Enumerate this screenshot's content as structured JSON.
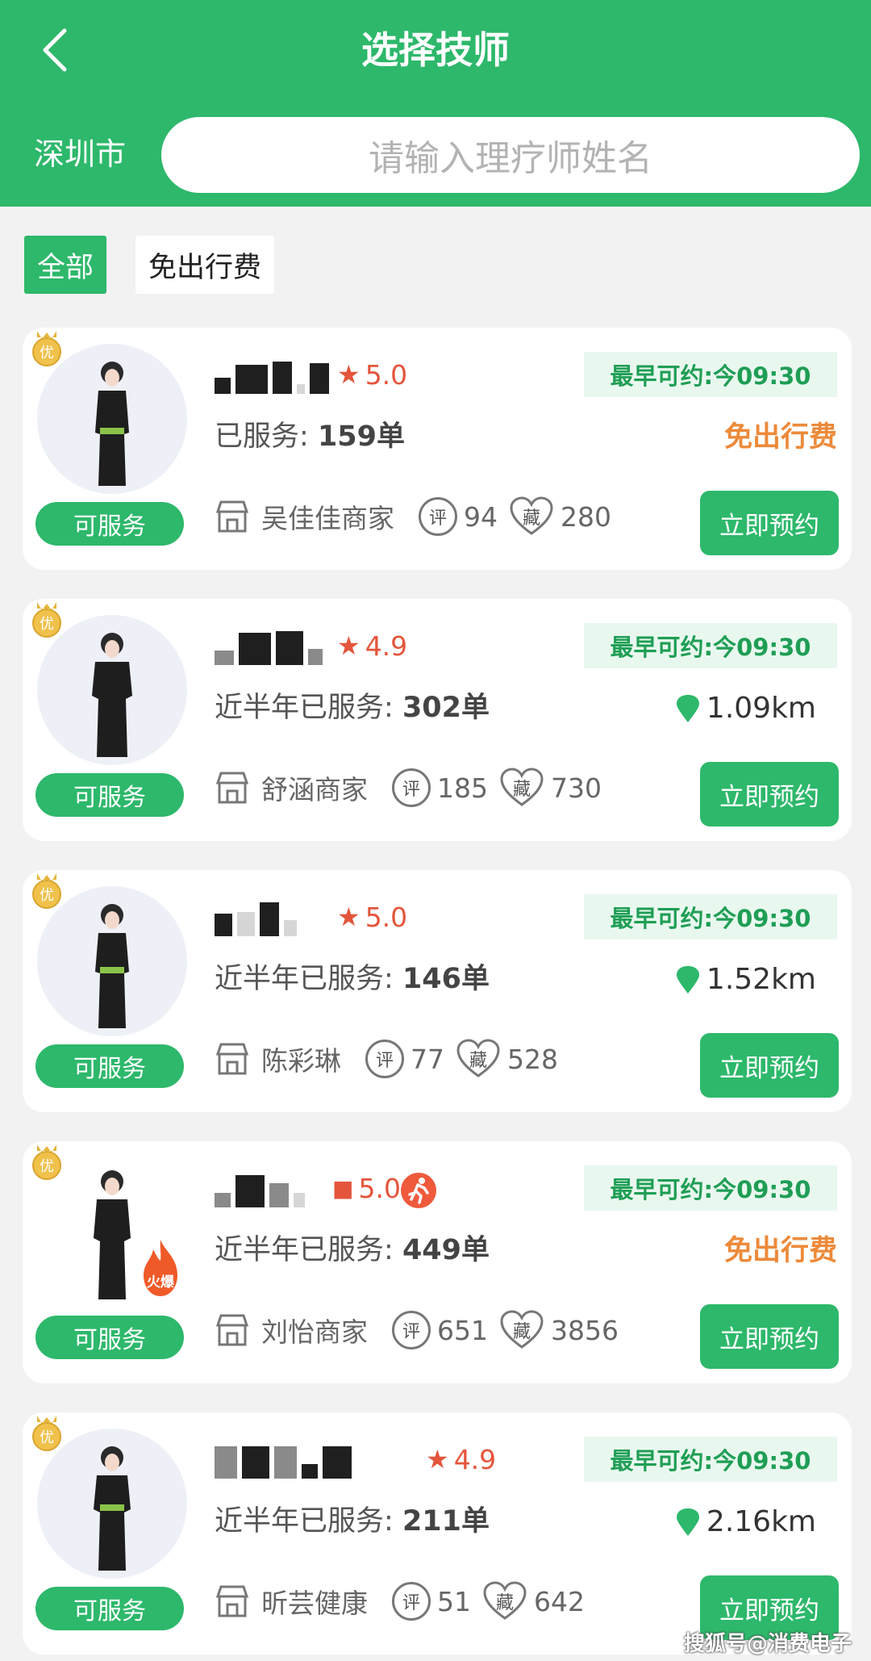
{
  "header": {
    "title": "选择技师",
    "city": "深圳市",
    "search_placeholder": "请输入理疗师姓名"
  },
  "filters": [
    "全部",
    "免出行费"
  ],
  "labels": {
    "earliest": "最早可约:今09:30",
    "status": "可服务",
    "book": "立即预约",
    "free_fee": "免出行费",
    "review_icon": "评",
    "fav_icon": "藏",
    "medal": "优",
    "hot": "火爆"
  },
  "cards": [
    {
      "rating": "5.0",
      "served_label": "已服务:",
      "served_count": "159单",
      "shop": "吴佳佳商家",
      "reviews": "94",
      "favorites": "280",
      "distance": "",
      "free_fee": true
    },
    {
      "rating": "4.9",
      "served_label": "近半年已服务:",
      "served_count": "302单",
      "shop": "舒涵商家",
      "reviews": "185",
      "favorites": "730",
      "distance": "1.09km",
      "free_fee": false
    },
    {
      "rating": "5.0",
      "served_label": "近半年已服务:",
      "served_count": "146单",
      "shop": "陈彩琳",
      "reviews": "77",
      "favorites": "528",
      "distance": "1.52km",
      "free_fee": false
    },
    {
      "rating": "5.0",
      "served_label": "近半年已服务:",
      "served_count": "449单",
      "shop": "刘怡商家",
      "reviews": "651",
      "favorites": "3856",
      "distance": "",
      "free_fee": true
    },
    {
      "rating": "4.9",
      "served_label": "近半年已服务:",
      "served_count": "211单",
      "shop": "昕芸健康",
      "reviews": "51",
      "favorites": "642",
      "distance": "2.16km",
      "free_fee": false
    }
  ],
  "watermark": "搜狐号@消费电子",
  "colors": {
    "primary": "#2db86b",
    "rating": "#e4553c",
    "free_fee": "#ec8a3a"
  }
}
